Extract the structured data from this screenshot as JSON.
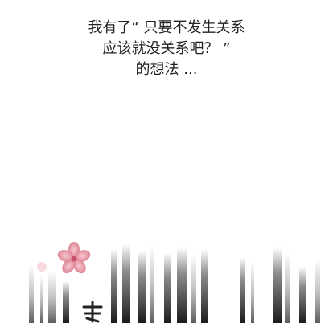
{
  "caption": {
    "line1": "我有了“ 只要不发生关系",
    "line2": "应该就没关系吧？ ”",
    "line3": "的想法 ..."
  },
  "colors": {
    "text": "#222222",
    "blossom": "#e79aa7",
    "ink": "#2b2b2b"
  }
}
